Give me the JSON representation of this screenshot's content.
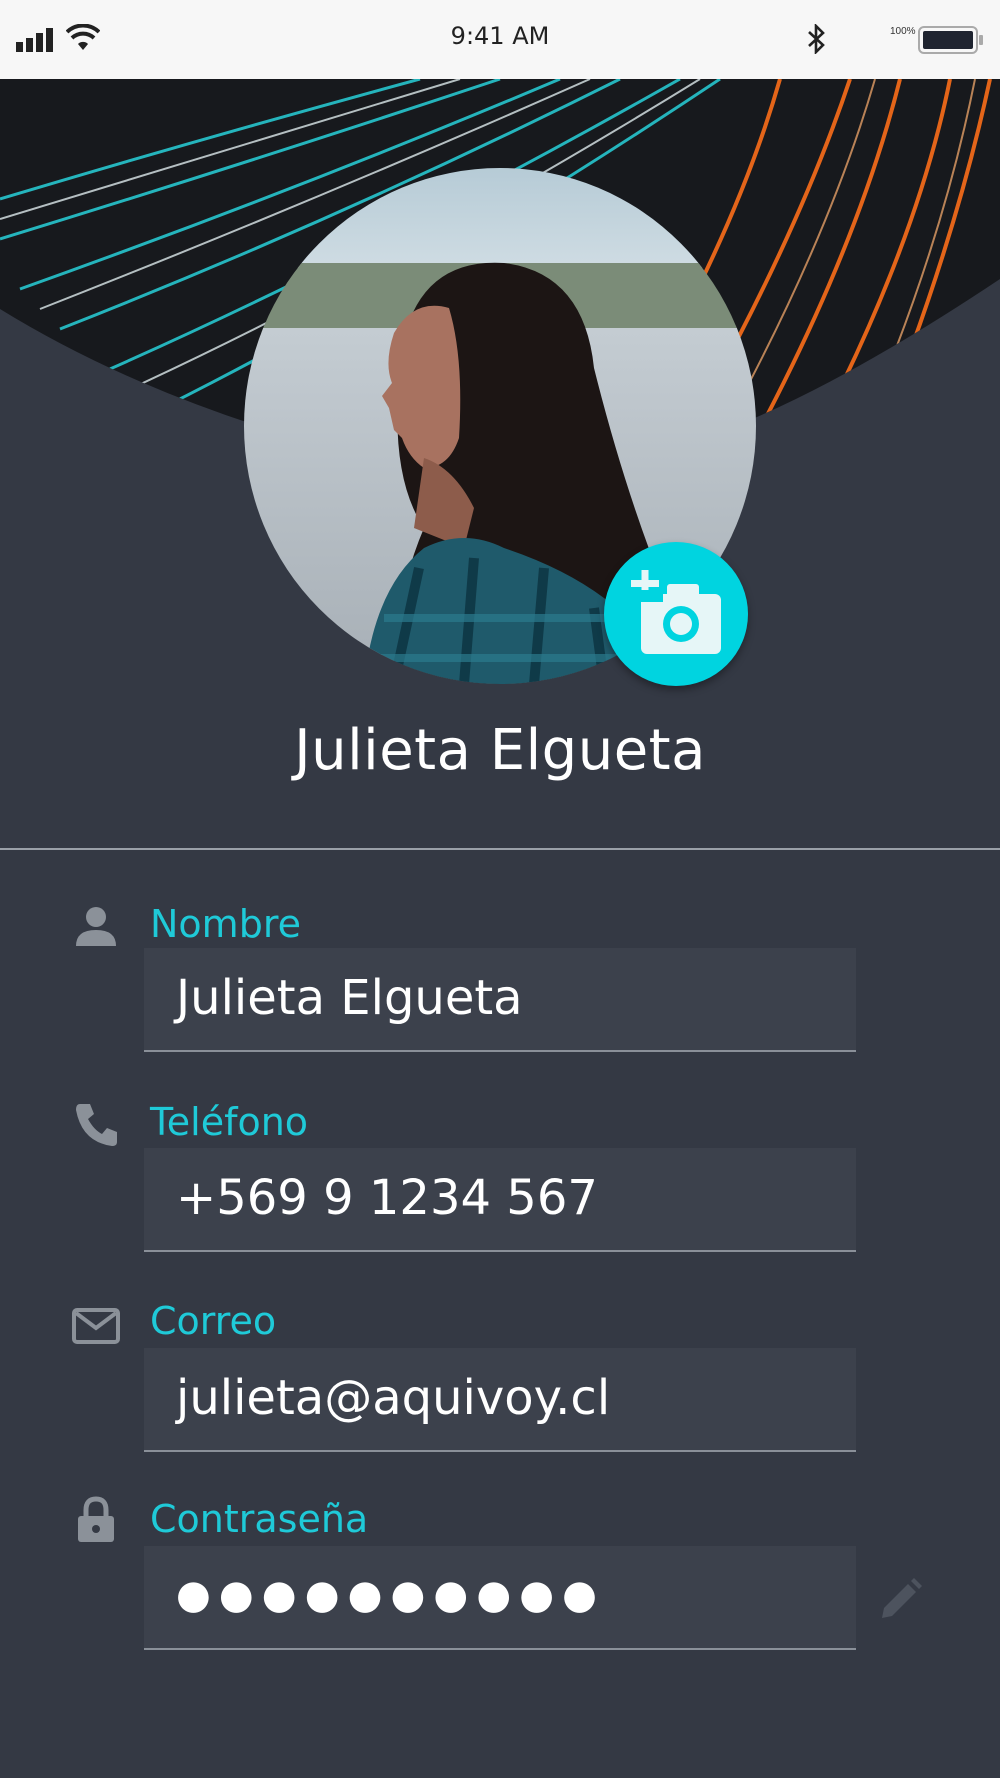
{
  "status_bar": {
    "time": "9:41 AM",
    "battery_percent": "100%",
    "icons": [
      "cellular-signal-icon",
      "wifi-icon",
      "bluetooth-icon",
      "battery-icon"
    ]
  },
  "profile": {
    "name": "Julieta Elgueta",
    "change_photo_icon": "add-a-photo-icon"
  },
  "fields": [
    {
      "icon": "person-icon",
      "label": "Nombre",
      "value": "Julieta Elgueta"
    },
    {
      "icon": "phone-icon",
      "label": "Teléfono",
      "value": "+569 9 1234 567"
    },
    {
      "icon": "mail-icon",
      "label": "Correo",
      "value": "julieta@aquivoy.cl"
    },
    {
      "icon": "lock-icon",
      "label": "Contraseña",
      "value": "●●●●●●●●●●"
    }
  ],
  "edit_password_icon": "pencil-icon",
  "colors": {
    "background": "#343944",
    "accent": "#00d4e0",
    "label": "#1fcad8",
    "field_background": "#3c414c",
    "icon": "#8b9199"
  }
}
